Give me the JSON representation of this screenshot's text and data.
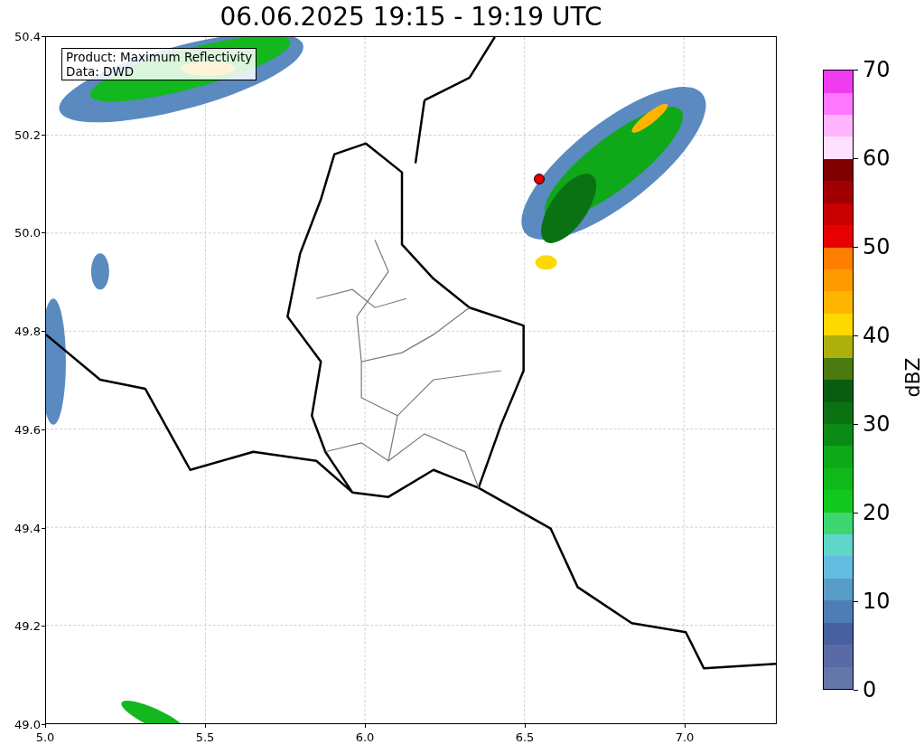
{
  "title": "06.06.2025 19:15 - 19:19 UTC",
  "info_box": [
    "Product: Maximum Reflectivity",
    "Data: DWD"
  ],
  "map": {
    "kind": "radar",
    "marker": {
      "color": "#e60000"
    },
    "yticks": [
      "50.4",
      "50.2",
      "50.0",
      "49.8",
      "49.6",
      "49.4",
      "49.2",
      "49.0"
    ],
    "xticks": [
      "5.0",
      "5.5",
      "6.0",
      "6.5",
      "7.0"
    ]
  },
  "colorbar": {
    "label": "dBZ",
    "ticks": [
      "70",
      "60",
      "50",
      "40",
      "30",
      "20",
      "10",
      "0"
    ],
    "bins": [
      {
        "color": "#6577a8"
      },
      {
        "color": "#5a6aa5"
      },
      {
        "color": "#4660a0"
      },
      {
        "color": "#4d7db5"
      },
      {
        "color": "#5a9cc8"
      },
      {
        "color": "#62bde0"
      },
      {
        "color": "#5fd6c8"
      },
      {
        "color": "#3ed670"
      },
      {
        "color": "#12c81e"
      },
      {
        "color": "#10b81a"
      },
      {
        "color": "#0fa818"
      },
      {
        "color": "#0c8a16"
      },
      {
        "color": "#0b7214"
      },
      {
        "color": "#0a5c10"
      },
      {
        "color": "#4a7a10"
      },
      {
        "color": "#adb00c"
      },
      {
        "color": "#ffd800"
      },
      {
        "color": "#ffb400"
      },
      {
        "color": "#ff9a00"
      },
      {
        "color": "#ff7e00"
      },
      {
        "color": "#e60000"
      },
      {
        "color": "#c80000"
      },
      {
        "color": "#a20000"
      },
      {
        "color": "#7e0000"
      },
      {
        "color": "#ffe0ff"
      },
      {
        "color": "#ffb4ff"
      },
      {
        "color": "#ff78ff"
      },
      {
        "color": "#f03cf0"
      }
    ]
  }
}
